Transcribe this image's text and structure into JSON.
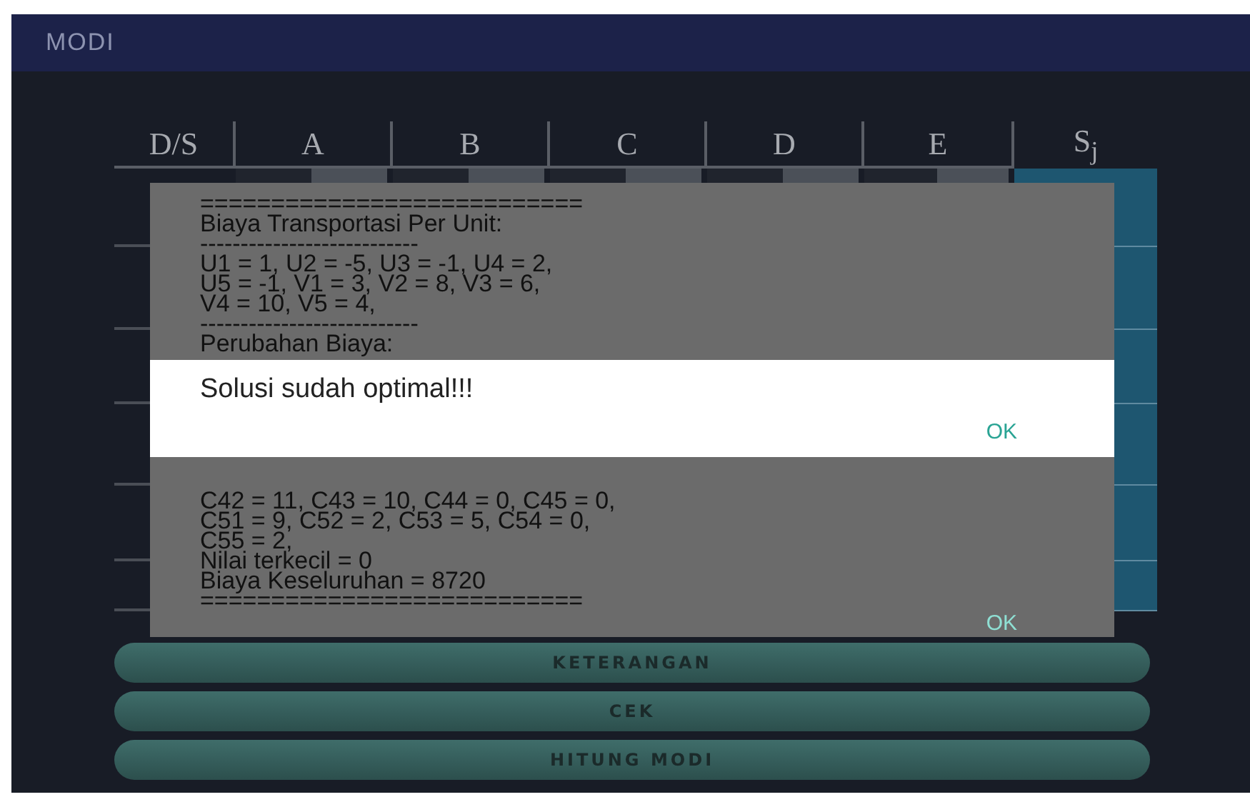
{
  "app_bar": {
    "title": "MODI"
  },
  "table": {
    "columns": [
      "D/S",
      "A",
      "B",
      "C",
      "D",
      "E",
      "S$_{j}$"
    ]
  },
  "buttons": [
    {
      "label": "KETERANGAN"
    },
    {
      "label": "CEK"
    },
    {
      "label": "HITUNG MODI"
    }
  ],
  "result_dialog": {
    "lines_top": [
      "===========================",
      "Biaya Transportasi Per Unit:",
      "---------------------------",
      "U1 = 1, U2 = -5, U3 = -1, U4 = 2,",
      "U5 = -1, V1 = 3, V2 = 8, V3 = 6,",
      "V4 = 10, V5 = 4,",
      "---------------------------",
      "Perubahan Biaya:"
    ],
    "lines_bottom": [
      "C42 = 11, C43 = 10, C44 = 0, C45 = 0,",
      "C51 = 9, C52 = 2, C53 = 5, C54 = 0,",
      "C55 = 2,",
      "Nilai terkecil = 0",
      "Biaya Keseluruhan = 8720",
      "==========================="
    ],
    "button": "OK"
  },
  "message_dialog": {
    "message": "Solusi sudah optimal!!!",
    "button": "OK"
  }
}
